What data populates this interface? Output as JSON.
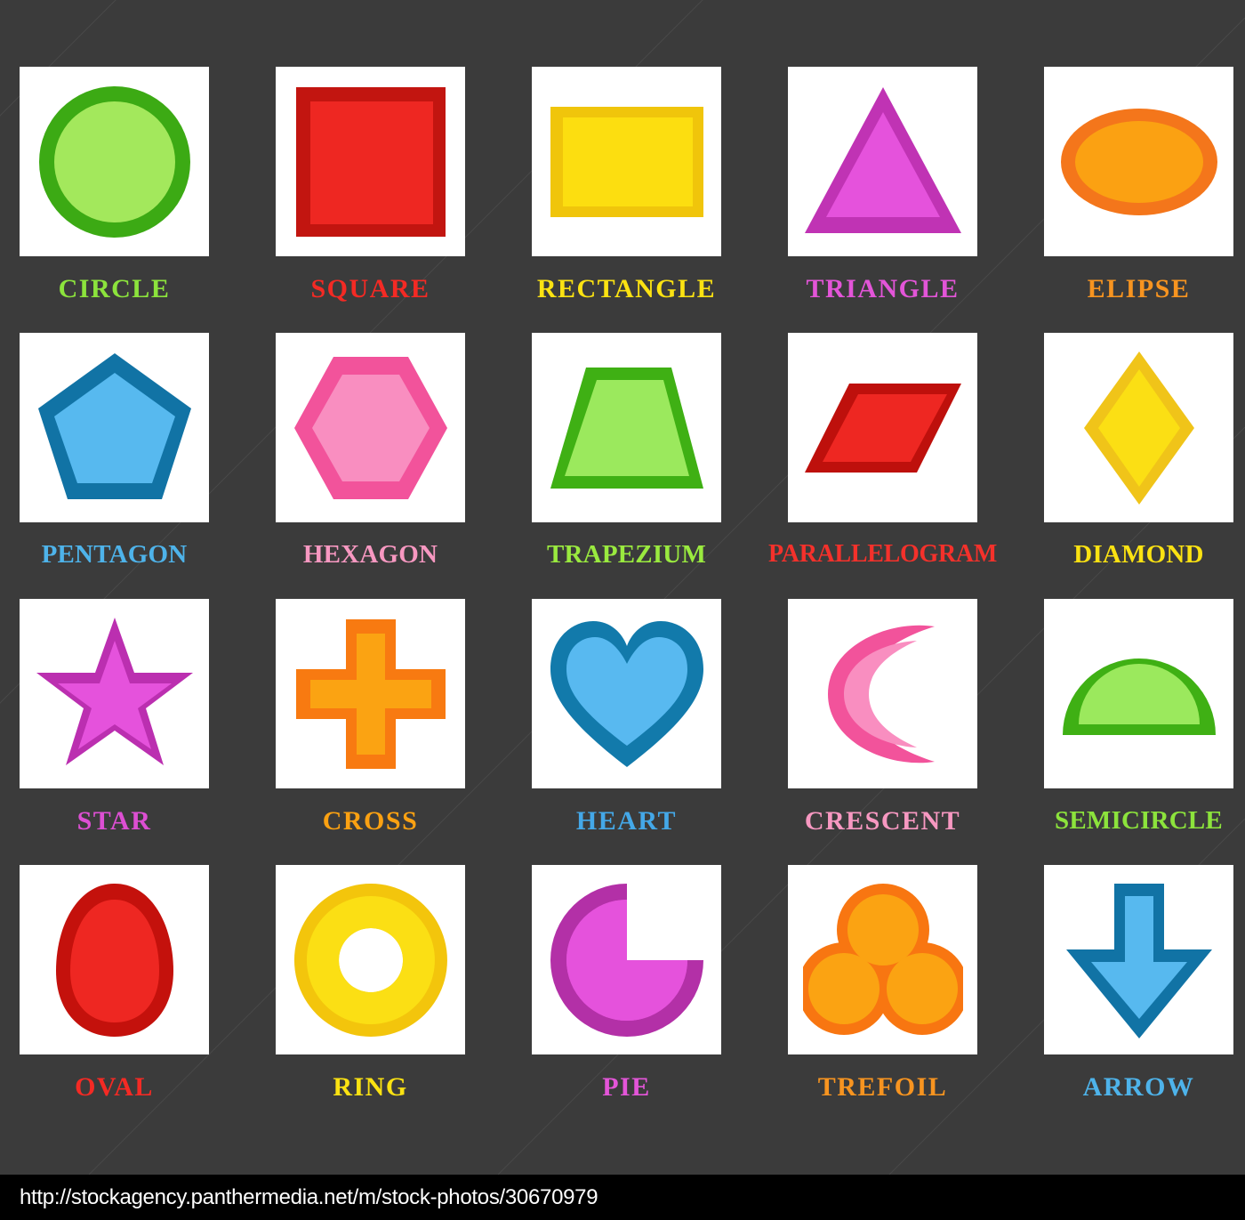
{
  "poster": {
    "background_color": "#3b3b3b",
    "card_background": "#ffffff"
  },
  "footer": {
    "url": "http://stockagency.panthermedia.net/m/stock-photos/30670979"
  },
  "shapes": [
    {
      "id": "circle",
      "label": "CIRCLE",
      "label_color": "#8CE33C",
      "fill": "#A3E85C",
      "stroke": "#3CAA14",
      "row": 1,
      "col": 1
    },
    {
      "id": "square",
      "label": "SQUARE",
      "label_color": "#F42A24",
      "fill": "#EE2722",
      "stroke": "#C21510",
      "row": 1,
      "col": 2
    },
    {
      "id": "rectangle",
      "label": "RECTANGLE",
      "label_color": "#FBE212",
      "fill": "#FCDE10",
      "stroke": "#F0C50B",
      "row": 1,
      "col": 3
    },
    {
      "id": "triangle",
      "label": "TRIANGLE",
      "label_color": "#E355D8",
      "fill": "#E552DC",
      "stroke": "#C033B4",
      "row": 1,
      "col": 4
    },
    {
      "id": "elipse",
      "label": "ELIPSE",
      "label_color": "#F79420",
      "fill": "#FBA112",
      "stroke": "#F4761B",
      "row": 1,
      "col": 5
    },
    {
      "id": "pentagon",
      "label": "PENTAGON",
      "label_color": "#4EB3EA",
      "fill": "#57B9EF",
      "stroke": "#1173A5",
      "row": 2,
      "col": 1
    },
    {
      "id": "hexagon",
      "label": "HEXAGON",
      "label_color": "#F798C1",
      "fill": "#F98EC0",
      "stroke": "#F2539B",
      "row": 2,
      "col": 2
    },
    {
      "id": "trapezium",
      "label": "TRAPEZIUM",
      "label_color": "#9AEA3F",
      "fill": "#9BE95D",
      "stroke": "#3FB014",
      "row": 2,
      "col": 3
    },
    {
      "id": "parallelogram",
      "label": "PARALLELOGRAM",
      "label_color": "#F4312B",
      "fill": "#EE2722",
      "stroke": "#BE100C",
      "row": 2,
      "col": 4
    },
    {
      "id": "diamond",
      "label": "DIAMOND",
      "label_color": "#FBE212",
      "fill": "#FBDF14",
      "stroke": "#F0C419",
      "row": 2,
      "col": 5
    },
    {
      "id": "star",
      "label": "STAR",
      "label_color": "#DD4FD3",
      "fill": "#E552DC",
      "stroke": "#BB2FB0",
      "row": 3,
      "col": 1
    },
    {
      "id": "cross",
      "label": "CROSS",
      "label_color": "#FBA112",
      "fill": "#FBA312",
      "stroke": "#F87A11",
      "row": 3,
      "col": 2
    },
    {
      "id": "heart",
      "label": "HEART",
      "label_color": "#44A8E8",
      "fill": "#58B9F0",
      "stroke": "#127AAB",
      "row": 3,
      "col": 3
    },
    {
      "id": "crescent",
      "label": "CRESCENT",
      "label_color": "#F798C1",
      "fill": "#F98EC0",
      "stroke": "#F2539B",
      "row": 3,
      "col": 4
    },
    {
      "id": "semicircle",
      "label": "SEMICIRCLE",
      "label_color": "#8CE33C",
      "fill": "#9BE95D",
      "stroke": "#3FB014",
      "row": 3,
      "col": 5
    },
    {
      "id": "oval",
      "label": "OVAL",
      "label_color": "#F42A24",
      "fill": "#EE2722",
      "stroke": "#C4110C",
      "row": 4,
      "col": 1
    },
    {
      "id": "ring",
      "label": "RING",
      "label_color": "#FBE212",
      "fill": "#FBDF14",
      "stroke": "#F3C50C",
      "row": 4,
      "col": 2
    },
    {
      "id": "pie",
      "label": "PIE",
      "label_color": "#E355D8",
      "fill": "#E552DC",
      "stroke": "#B330A7",
      "row": 4,
      "col": 3
    },
    {
      "id": "trefoil",
      "label": "TREFOIL",
      "label_color": "#F79420",
      "fill": "#FBA312",
      "stroke": "#F87611",
      "row": 4,
      "col": 4
    },
    {
      "id": "arrow",
      "label": "ARROW",
      "label_color": "#4EB3EA",
      "fill": "#57B9EF",
      "stroke": "#1173A5",
      "row": 4,
      "col": 5
    }
  ]
}
